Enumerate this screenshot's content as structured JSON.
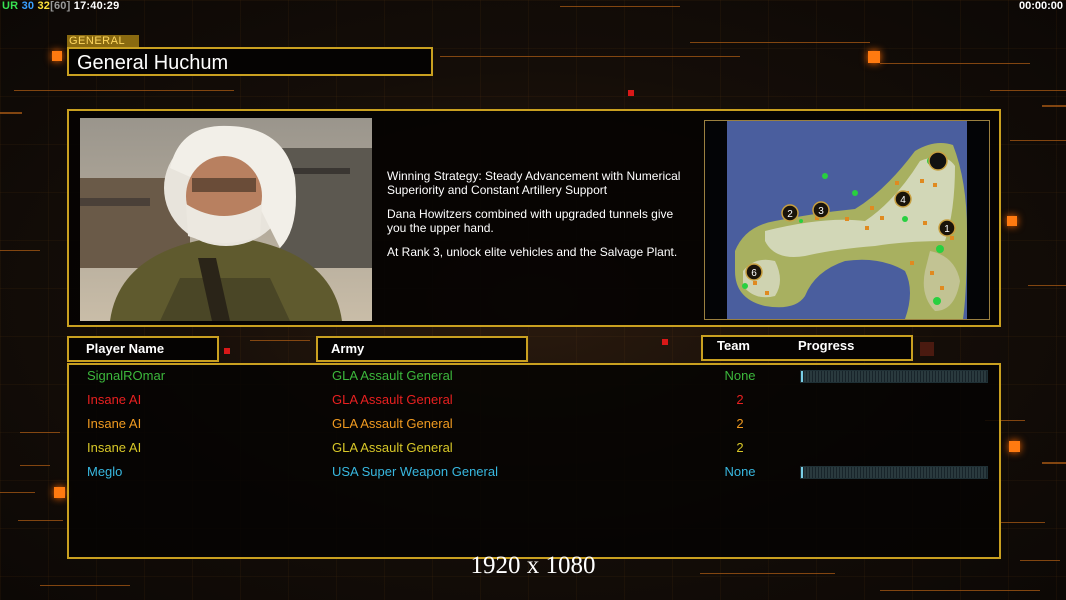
{
  "hud": {
    "left": [
      "UR",
      "30",
      "32",
      "[60]",
      "17:40:29"
    ],
    "right": "00:00:00"
  },
  "general": {
    "tag": "GENERAL",
    "name": "General Huchum"
  },
  "description": {
    "lines": [
      "Winning Strategy: Steady Advancement with Numerical\n Superiority and Constant Artillery Support",
      "Dana Howitzers combined with upgraded tunnels give\n you the upper hand.",
      "At Rank 3, unlock elite vehicles and the Salvage Plant."
    ]
  },
  "minimap": {
    "start_markers": [
      "1",
      "2",
      "3",
      "4",
      "6"
    ]
  },
  "headers": {
    "player_name": "Player Name",
    "army": "Army",
    "team": "Team",
    "progress": "Progress"
  },
  "players": [
    {
      "name": "SignalROmar",
      "army": "GLA Assault General",
      "team": "None",
      "color": "#3cb83c",
      "progress": 0.01,
      "show_progress": true
    },
    {
      "name": "Insane AI",
      "army": "GLA Assault General",
      "team": "2",
      "color": "#e82020",
      "progress": 0,
      "show_progress": false
    },
    {
      "name": "Insane AI",
      "army": "GLA Assault General",
      "team": "2",
      "color": "#f09a20",
      "progress": 0,
      "show_progress": false
    },
    {
      "name": "Insane AI",
      "army": "GLA Assault General",
      "team": "2",
      "color": "#d8c828",
      "progress": 0,
      "show_progress": false
    },
    {
      "name": "Meglo",
      "army": "USA Super Weapon General",
      "team": "None",
      "color": "#38b8e0",
      "progress": 0.01,
      "show_progress": true
    }
  ],
  "resolution_label": "1920 x 1080",
  "colors": {
    "frame": "#c9a020",
    "accent": "#ff7a10"
  }
}
